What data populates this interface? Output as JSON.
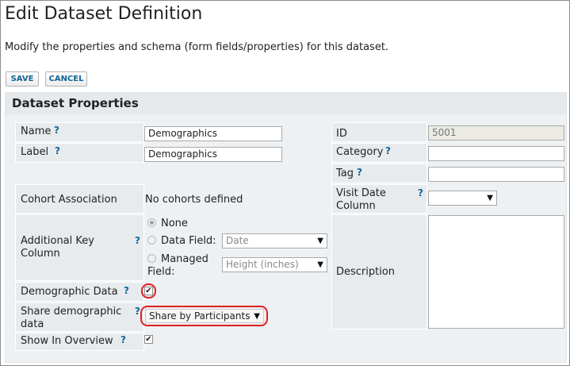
{
  "page": {
    "title": "Edit Dataset Definition",
    "description": "Modify the properties and schema (form fields/properties) for this dataset."
  },
  "toolbar": {
    "save_label": "SAVE",
    "cancel_label": "CANCEL"
  },
  "panel": {
    "title": "Dataset Properties"
  },
  "help_mark": "?",
  "left_fields": {
    "name": {
      "label": "Name",
      "value": "Demographics"
    },
    "label": {
      "label": "Label",
      "value": "Demographics"
    },
    "cohort": {
      "label": "Cohort Association",
      "value": "No cohorts defined"
    },
    "additional_key": {
      "label_line1": "Additional Key",
      "label_line2": "Column",
      "option_none": "None",
      "option_data_field": "Data Field:",
      "data_field_value": "Date",
      "option_managed_line1": "Managed",
      "option_managed_line2": "Field:",
      "managed_field_value": "Height (inches)",
      "selected": "None"
    },
    "demographic": {
      "label": "Demographic Data",
      "checked": true
    },
    "share": {
      "label_line1": "Share demographic",
      "label_line2": "data",
      "value": "Share by Participants"
    },
    "overview": {
      "label": "Show In Overview",
      "checked": true
    }
  },
  "right_fields": {
    "id": {
      "label": "ID",
      "value": "5001"
    },
    "category": {
      "label": "Category",
      "value": ""
    },
    "tag": {
      "label": "Tag",
      "value": ""
    },
    "visit_date": {
      "label_line1": "Visit Date",
      "label_line2": "Column",
      "value": ""
    },
    "description": {
      "label": "Description",
      "value": ""
    }
  },
  "colors": {
    "link_blue": "#126495",
    "highlight_red": "#e02020",
    "panel_header": "#e5e9ec"
  }
}
